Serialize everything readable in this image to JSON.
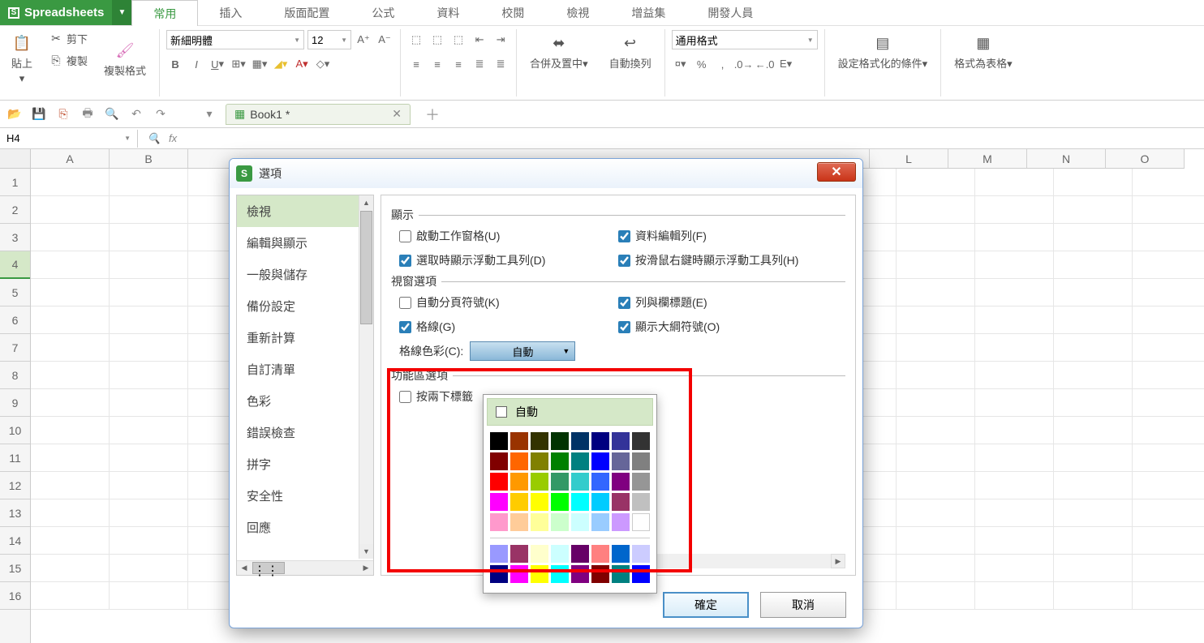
{
  "app": {
    "name": "Spreadsheets"
  },
  "menu_tabs": [
    "常用",
    "插入",
    "版面配置",
    "公式",
    "資料",
    "校閱",
    "檢視",
    "增益集",
    "開發人員"
  ],
  "ribbon": {
    "paste": "貼上",
    "cut": "剪下",
    "copy": "複製",
    "format_painter": "複製格式",
    "font_name": "新細明體",
    "font_size": "12",
    "merge_center": "合併及置中",
    "wrap": "自動換列",
    "number_format": "通用格式",
    "cond_fmt": "設定格式化的條件",
    "as_table": "格式為表格"
  },
  "doc_tab": {
    "name": "Book1 *"
  },
  "namebox": "H4",
  "columns": [
    "A",
    "B",
    "L",
    "M",
    "N",
    "O"
  ],
  "rows": [
    "1",
    "2",
    "3",
    "4",
    "5",
    "6",
    "7",
    "8",
    "9",
    "10",
    "11",
    "12",
    "13",
    "14",
    "15",
    "16"
  ],
  "dialog": {
    "title": "選項",
    "side_items": [
      "檢視",
      "編輯與顯示",
      "一般與儲存",
      "備份設定",
      "重新計算",
      "自訂清單",
      "色彩",
      "錯誤檢查",
      "拼字",
      "安全性",
      "回應"
    ],
    "sections": {
      "display": "顯示",
      "window": "視窗選項",
      "ribbon": "功能區選項"
    },
    "display_opts": [
      {
        "label": "啟動工作窗格(U)",
        "checked": false
      },
      {
        "label": "資料編輯列(F)",
        "checked": true
      },
      {
        "label": "選取時顯示浮動工具列(D)",
        "checked": true
      },
      {
        "label": "按滑鼠右鍵時顯示浮動工具列(H)",
        "checked": true
      }
    ],
    "window_opts": [
      {
        "label": "自動分頁符號(K)",
        "checked": false
      },
      {
        "label": "列與欄標題(E)",
        "checked": true
      },
      {
        "label": "格線(G)",
        "checked": true
      },
      {
        "label": "顯示大綱符號(O)",
        "checked": true
      }
    ],
    "grid_color_label": "格線色彩(C):",
    "grid_color_value": "自動",
    "ribbon_opt": "按兩下標籤",
    "ok": "確定",
    "cancel": "取消"
  },
  "palette": {
    "auto": "自動",
    "row1": [
      "#000000",
      "#993300",
      "#333300",
      "#003300",
      "#003366",
      "#000080",
      "#333399",
      "#333333"
    ],
    "row2": [
      "#800000",
      "#ff6600",
      "#808000",
      "#008000",
      "#008080",
      "#0000ff",
      "#666699",
      "#808080"
    ],
    "row3": [
      "#ff0000",
      "#ff9900",
      "#99cc00",
      "#339966",
      "#33cccc",
      "#3366ff",
      "#800080",
      "#969696"
    ],
    "row4": [
      "#ff00ff",
      "#ffcc00",
      "#ffff00",
      "#00ff00",
      "#00ffff",
      "#00ccff",
      "#993366",
      "#c0c0c0"
    ],
    "row5": [
      "#ff99cc",
      "#ffcc99",
      "#ffff99",
      "#ccffcc",
      "#ccffff",
      "#99ccff",
      "#cc99ff",
      "#ffffff"
    ],
    "row6": [
      "#9999ff",
      "#993366",
      "#ffffcc",
      "#ccffff",
      "#660066",
      "#ff8080",
      "#0066cc",
      "#ccccff"
    ],
    "row7": [
      "#000080",
      "#ff00ff",
      "#ffff00",
      "#00ffff",
      "#800080",
      "#800000",
      "#008080",
      "#0000ff"
    ]
  }
}
